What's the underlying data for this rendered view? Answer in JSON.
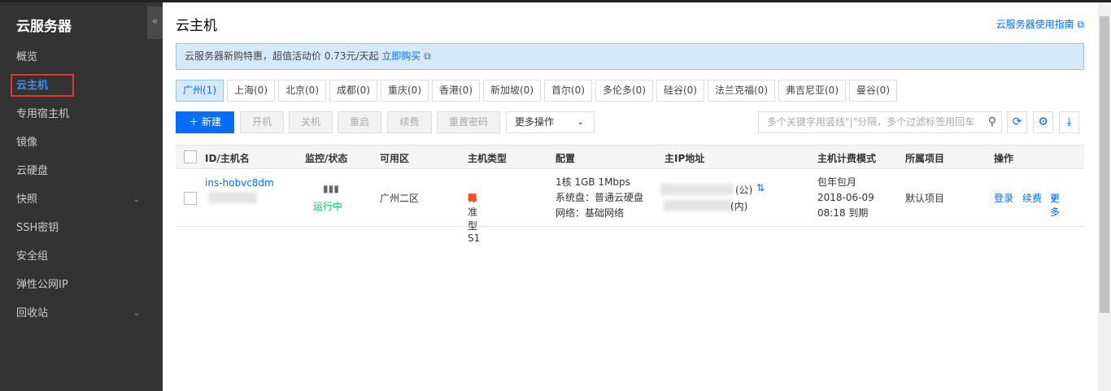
{
  "sidebar": {
    "title": "云服务器",
    "collapse_icon": "«",
    "items": [
      {
        "label": "概览"
      },
      {
        "label": "云主机",
        "active": true
      },
      {
        "label": "专用宿主机"
      },
      {
        "label": "镜像"
      },
      {
        "label": "云硬盘"
      },
      {
        "label": "快照",
        "expand": true
      },
      {
        "label": "SSH密钥"
      },
      {
        "label": "安全组"
      },
      {
        "label": "弹性公网IP"
      },
      {
        "label": "回收站",
        "expand": true
      }
    ]
  },
  "header": {
    "title": "云主机",
    "guide_link": "云服务器使用指南"
  },
  "banner": {
    "text": "云服务器新购特惠，超值活动价 0.73元/天起",
    "link": "立即购买"
  },
  "regions": [
    "广州(1)",
    "上海(0)",
    "北京(0)",
    "成都(0)",
    "重庆(0)",
    "香港(0)",
    "新加坡(0)",
    "首尔(0)",
    "多伦多(0)",
    "硅谷(0)",
    "法兰克福(0)",
    "弗吉尼亚(0)",
    "曼谷(0)"
  ],
  "toolbar": {
    "new": "新建",
    "start": "开机",
    "stop": "关机",
    "restart": "重启",
    "renew": "续费",
    "reset_pwd": "重置密码",
    "more": "更多操作",
    "search_placeholder": "多个关键字用竖线\"|\"分隔，多个过滤标签用回车"
  },
  "table": {
    "headers": [
      "ID/主机名",
      "监控/状态",
      "可用区",
      "主机类型",
      "配置",
      "主IP地址",
      "主机计费模式",
      "所属项目",
      "操作"
    ],
    "rows": [
      {
        "id": "ins-hobvc8dm",
        "status": "运行中",
        "zone": "广州二区",
        "type": "标准型S1",
        "config": [
          "1核 1GB 1Mbps",
          "系统盘：普通云硬盘",
          "网络：基础网络"
        ],
        "ip_public_suffix": "(公)",
        "ip_private_suffix": "(内)",
        "billing": [
          "包年包月",
          "2018-06-09",
          "08:18 到期"
        ],
        "project": "默认项目",
        "actions": [
          "登录",
          "续费",
          "更多"
        ]
      }
    ]
  }
}
